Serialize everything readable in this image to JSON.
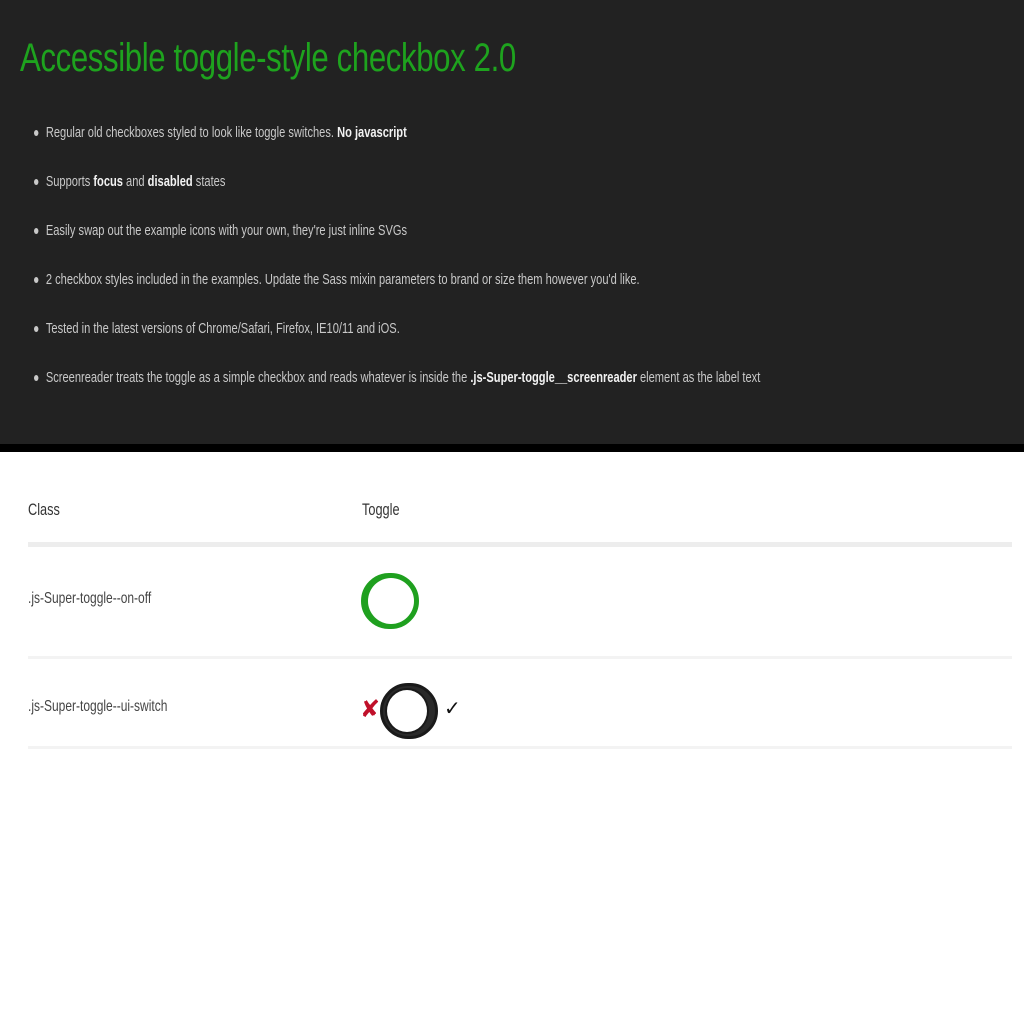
{
  "hero": {
    "title": "Accessible toggle-style checkbox 2.0",
    "features": [
      [
        {
          "t": "Regular old checkboxes styled to look like toggle switches. ",
          "b": false
        },
        {
          "t": "No javascript",
          "b": true
        }
      ],
      [
        {
          "t": "Supports ",
          "b": false
        },
        {
          "t": "focus",
          "b": true
        },
        {
          "t": " and ",
          "b": false
        },
        {
          "t": "disabled",
          "b": true
        },
        {
          "t": " states",
          "b": false
        }
      ],
      [
        {
          "t": "Easily swap out the example icons with your own, they're just inline SVGs",
          "b": false
        }
      ],
      [
        {
          "t": "2 checkbox styles included in the examples. Update the Sass mixin parameters to brand or size them however you'd like.",
          "b": false
        }
      ],
      [
        {
          "t": "Tested in the latest versions of Chrome/Safari, Firefox, IE10/11 and iOS.",
          "b": false
        }
      ],
      [
        {
          "t": "Screenreader treats the toggle as a simple checkbox and reads whatever is inside the ",
          "b": false
        },
        {
          "t": ".js-Super-toggle__screenreader",
          "b": true
        },
        {
          "t": " element as the label text",
          "b": false
        }
      ]
    ]
  },
  "table": {
    "headers": {
      "class": "Class",
      "toggle": "Toggle"
    },
    "rows": [
      {
        "class": ".js-Super-toggle--on-off",
        "state": "on",
        "icon_on": "check-icon"
      },
      {
        "class": ".js-Super-toggle--ui-switch",
        "state": "off",
        "icon_off": "x-icon",
        "icon_on": "check-icon"
      }
    ]
  },
  "colors": {
    "hero_bg": "#222222",
    "title_green": "#1ea31e",
    "toggle_green": "#1fa01f",
    "x_red": "#c0102a"
  },
  "glyphs": {
    "check": "✔",
    "x": "✘",
    "check_plain": "✓"
  }
}
